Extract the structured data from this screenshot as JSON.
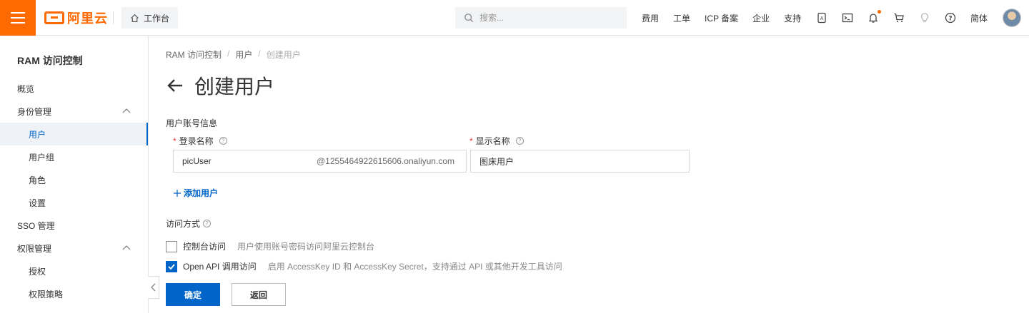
{
  "topbar": {
    "logo_text": "阿里云",
    "workbench_label": "工作台",
    "search_placeholder": "搜索...",
    "nav_links": [
      "费用",
      "工单",
      "ICP 备案",
      "企业",
      "支持"
    ],
    "language": "简体",
    "accent_color": "#ff6a00"
  },
  "sidebar": {
    "title": "RAM 访问控制",
    "items": [
      {
        "label": "概览",
        "level": 1
      },
      {
        "label": "身份管理",
        "level": 1,
        "expanded": true
      },
      {
        "label": "用户",
        "level": 2,
        "active": true
      },
      {
        "label": "用户组",
        "level": 2
      },
      {
        "label": "角色",
        "level": 2
      },
      {
        "label": "设置",
        "level": 2
      },
      {
        "label": "SSO 管理",
        "level": 1
      },
      {
        "label": "权限管理",
        "level": 1,
        "expanded": true
      },
      {
        "label": "授权",
        "level": 2
      },
      {
        "label": "权限策略",
        "level": 2
      }
    ]
  },
  "breadcrumb": [
    "RAM 访问控制",
    "用户",
    "创建用户"
  ],
  "page": {
    "title": "创建用户",
    "section_label": "用户账号信息",
    "login_name_label": "登录名称",
    "display_name_label": "显示名称",
    "login_name_value": "picUser",
    "login_name_suffix": "@1255464922615606.onaliyun.com",
    "display_name_value": "图床用户",
    "add_user_label": "添加用户",
    "access_label": "访问方式",
    "console_access_label": "控制台访问",
    "console_access_desc": "用户使用账号密码访问阿里云控制台",
    "console_access_checked": false,
    "api_access_label": "Open API 调用访问",
    "api_access_desc": "启用 AccessKey ID 和 AccessKey Secret，支持通过 API 或其他开发工具访问",
    "api_access_checked": true,
    "confirm_label": "确定",
    "back_label": "返回",
    "primary_color": "#0064c8"
  }
}
